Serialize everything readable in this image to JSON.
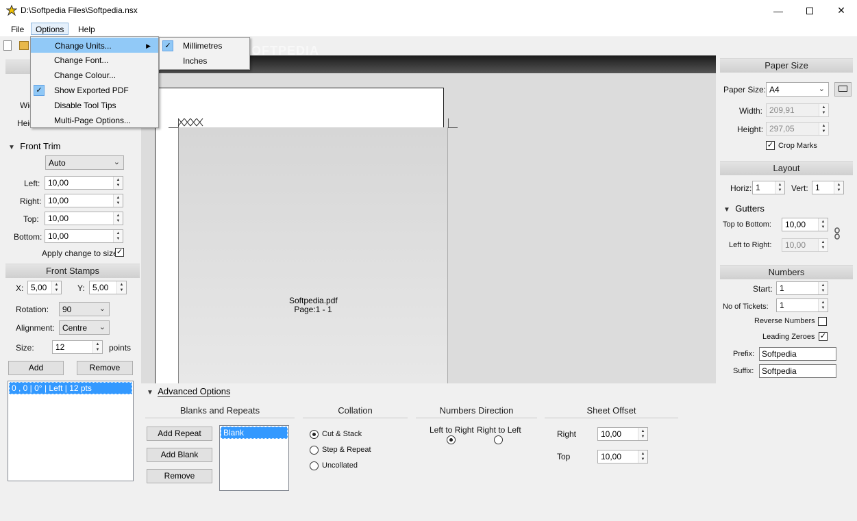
{
  "window": {
    "title": "D:\\Softpedia Files\\Softpedia.nsx"
  },
  "menubar": {
    "items": [
      "File",
      "Options",
      "Help"
    ]
  },
  "options_menu": {
    "items": [
      "Change Units...",
      "Change Font...",
      "Change Colour...",
      "Show Exported PDF",
      "Disable Tool Tips",
      "Multi-Page Options..."
    ]
  },
  "units_submenu": {
    "items": [
      "Millimetres",
      "Inches"
    ]
  },
  "left_panel": {
    "width_label": "Wid",
    "height_label": "Heig",
    "front_trim": {
      "header": "Front Trim",
      "mode": "Auto",
      "left_label": "Left:",
      "left_value": "10,00",
      "right_label": "Right:",
      "right_value": "10,00",
      "top_label": "Top:",
      "top_value": "10,00",
      "bottom_label": "Bottom:",
      "bottom_value": "10,00",
      "apply_label": "Apply change to size"
    },
    "front_stamps": {
      "header": "Front Stamps",
      "x_label": "X:",
      "x_value": "5,00",
      "y_label": "Y:",
      "y_value": "5,00",
      "rotation_label": "Rotation:",
      "rotation_value": "90",
      "alignment_label": "Alignment:",
      "alignment_value": "Centre",
      "size_label": "Size:",
      "size_value": "12",
      "size_unit": "points",
      "add_label": "Add",
      "remove_label": "Remove",
      "list": [
        "0 , 0 | 0° | Left | 12 pts"
      ]
    }
  },
  "preview": {
    "filename": "Softpedia.pdf",
    "page": "Page:1 - 1",
    "watermark": "SOFTPEDIA"
  },
  "right_panel": {
    "paper_size": {
      "header": "Paper Size",
      "size_label": "Paper Size:",
      "size_value": "A4",
      "width_label": "Width:",
      "width_value": "209,91",
      "height_label": "Height:",
      "height_value": "297,05",
      "crop_label": "Crop Marks"
    },
    "layout": {
      "header": "Layout",
      "horiz_label": "Horiz:",
      "horiz_value": "1",
      "vert_label": "Vert:",
      "vert_value": "1",
      "gutters_label": "Gutters",
      "ttb_label": "Top to Bottom:",
      "ttb_value": "10,00",
      "ltr_label": "Left to Right:",
      "ltr_value": "10,00"
    },
    "numbers": {
      "header": "Numbers",
      "start_label": "Start:",
      "start_value": "1",
      "tickets_label": "No of Tickets:",
      "tickets_value": "1",
      "reverse_label": "Reverse Numbers",
      "leading_label": "Leading Zeroes",
      "prefix_label": "Prefix:",
      "prefix_value": "Softpedia",
      "suffix_label": "Suffix:",
      "suffix_value": "Softpedia"
    }
  },
  "advanced": {
    "header": "Advanced Options",
    "blanks": {
      "title": "Blanks and Repeats",
      "add_repeat": "Add Repeat",
      "add_blank": "Add Blank",
      "remove": "Remove",
      "list": [
        "Blank"
      ]
    },
    "collation": {
      "title": "Collation",
      "options": [
        "Cut & Stack",
        "Step & Repeat",
        "Uncollated"
      ]
    },
    "direction": {
      "title": "Numbers Direction",
      "ltr": "Left to Right",
      "rtl": "Right to Left"
    },
    "offset": {
      "title": "Sheet Offset",
      "right_label": "Right",
      "right_value": "10,00",
      "top_label": "Top",
      "top_value": "10,00"
    }
  }
}
